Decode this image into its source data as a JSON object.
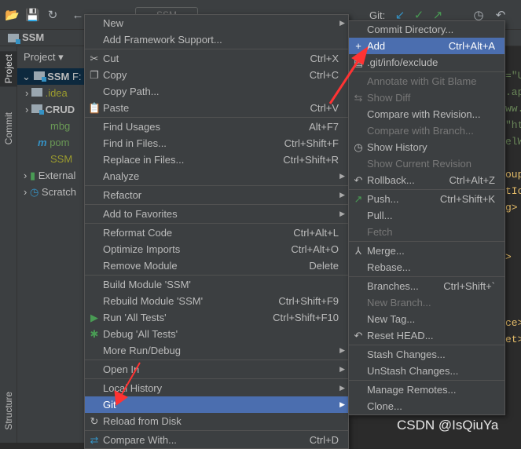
{
  "toolbar": {
    "git_label": "Git:",
    "run_config": "SSM"
  },
  "navbar": {
    "project": "SSM"
  },
  "left_strip": {
    "tabs": [
      "Project",
      "Commit",
      "Structure"
    ]
  },
  "project_panel": {
    "view_label": "Project",
    "tree": [
      {
        "label": "SSM",
        "suffix": "F:",
        "color": "#bbbbbb"
      },
      {
        "label": ".idea",
        "color": "#9c9c2e"
      },
      {
        "label": "CRUD",
        "color": "#bbbbbb"
      },
      {
        "label": "mbg",
        "color": "#6a9955"
      },
      {
        "label": "pom",
        "color": "#6a9955"
      },
      {
        "label": "SSM",
        "color": "#9c9c2e"
      },
      {
        "label": "External",
        "color": "#bbbbbb"
      },
      {
        "label": "Scratch",
        "color": "#bbbbbb"
      }
    ]
  },
  "editor": {
    "lines": [
      "=\"U",
      ".ap",
      "ww.",
      "\"ht",
      "elW",
      "",
      "oup",
      "tIc",
      "g>",
      "",
      "",
      ">",
      "",
      "",
      "",
      "ce>",
      "et>"
    ]
  },
  "context_menu": {
    "items": [
      {
        "label": "New",
        "arrow": true
      },
      {
        "label": "Add Framework Support..."
      },
      {
        "sep": true
      },
      {
        "label": "Cut",
        "shortcut": "Ctrl+X",
        "icon": "scissors-icon"
      },
      {
        "label": "Copy",
        "shortcut": "Ctrl+C",
        "icon": "copy-icon"
      },
      {
        "label": "Copy Path..."
      },
      {
        "label": "Paste",
        "shortcut": "Ctrl+V",
        "icon": "clipboard-icon"
      },
      {
        "sep": true
      },
      {
        "label": "Find Usages",
        "shortcut": "Alt+F7"
      },
      {
        "label": "Find in Files...",
        "shortcut": "Ctrl+Shift+F"
      },
      {
        "label": "Replace in Files...",
        "shortcut": "Ctrl+Shift+R"
      },
      {
        "label": "Analyze",
        "arrow": true
      },
      {
        "sep": true
      },
      {
        "label": "Refactor",
        "arrow": true
      },
      {
        "sep": true
      },
      {
        "label": "Add to Favorites",
        "arrow": true
      },
      {
        "sep": true
      },
      {
        "label": "Reformat Code",
        "shortcut": "Ctrl+Alt+L"
      },
      {
        "label": "Optimize Imports",
        "shortcut": "Ctrl+Alt+O"
      },
      {
        "label": "Remove Module",
        "shortcut": "Delete"
      },
      {
        "sep": true
      },
      {
        "label": "Build Module 'SSM'"
      },
      {
        "label": "Rebuild Module 'SSM'",
        "shortcut": "Ctrl+Shift+F9"
      },
      {
        "label": "Run 'All Tests'",
        "shortcut": "Ctrl+Shift+F10",
        "icon": "run-icon"
      },
      {
        "label": "Debug 'All Tests'",
        "icon": "debug-icon"
      },
      {
        "label": "More Run/Debug",
        "arrow": true
      },
      {
        "sep": true
      },
      {
        "label": "Open In",
        "arrow": true
      },
      {
        "sep": true
      },
      {
        "label": "Local History",
        "arrow": true
      },
      {
        "label": "Git",
        "arrow": true,
        "highlighted": true
      },
      {
        "label": "Reload from Disk",
        "icon": "reload-icon"
      },
      {
        "sep": true
      },
      {
        "label": "Compare With...",
        "shortcut": "Ctrl+D",
        "icon": "compare-icon"
      }
    ]
  },
  "git_submenu": {
    "items": [
      {
        "label": "Commit Directory..."
      },
      {
        "label": "Add",
        "shortcut": "Ctrl+Alt+A",
        "icon": "plus-icon",
        "highlighted": true
      },
      {
        "label": ".git/info/exclude",
        "icon": "file-icon"
      },
      {
        "sep": true
      },
      {
        "label": "Annotate with Git Blame",
        "disabled": true
      },
      {
        "label": "Show Diff",
        "disabled": true,
        "icon": "diff-icon"
      },
      {
        "label": "Compare with Revision..."
      },
      {
        "label": "Compare with Branch...",
        "disabled": true
      },
      {
        "label": "Show History",
        "icon": "clock-icon"
      },
      {
        "label": "Show Current Revision",
        "disabled": true
      },
      {
        "label": "Rollback...",
        "shortcut": "Ctrl+Alt+Z",
        "icon": "undo-icon"
      },
      {
        "sep": true
      },
      {
        "label": "Push...",
        "shortcut": "Ctrl+Shift+K",
        "icon": "push-icon"
      },
      {
        "label": "Pull..."
      },
      {
        "label": "Fetch",
        "disabled": true
      },
      {
        "sep": true
      },
      {
        "label": "Merge...",
        "icon": "merge-icon"
      },
      {
        "label": "Rebase..."
      },
      {
        "sep": true
      },
      {
        "label": "Branches...",
        "shortcut": "Ctrl+Shift+`"
      },
      {
        "label": "New Branch...",
        "disabled": true
      },
      {
        "label": "New Tag..."
      },
      {
        "label": "Reset HEAD...",
        "icon": "undo-icon"
      },
      {
        "sep": true
      },
      {
        "label": "Stash Changes..."
      },
      {
        "label": "UnStash Changes..."
      },
      {
        "sep": true
      },
      {
        "label": "Manage Remotes..."
      },
      {
        "label": "Clone..."
      }
    ]
  },
  "watermark": "CSDN @IsQiuYa",
  "colors": {
    "highlight": "#4b6eaf",
    "menu_bg": "#3c3f41",
    "annotation_arrow": "#ff3333"
  }
}
